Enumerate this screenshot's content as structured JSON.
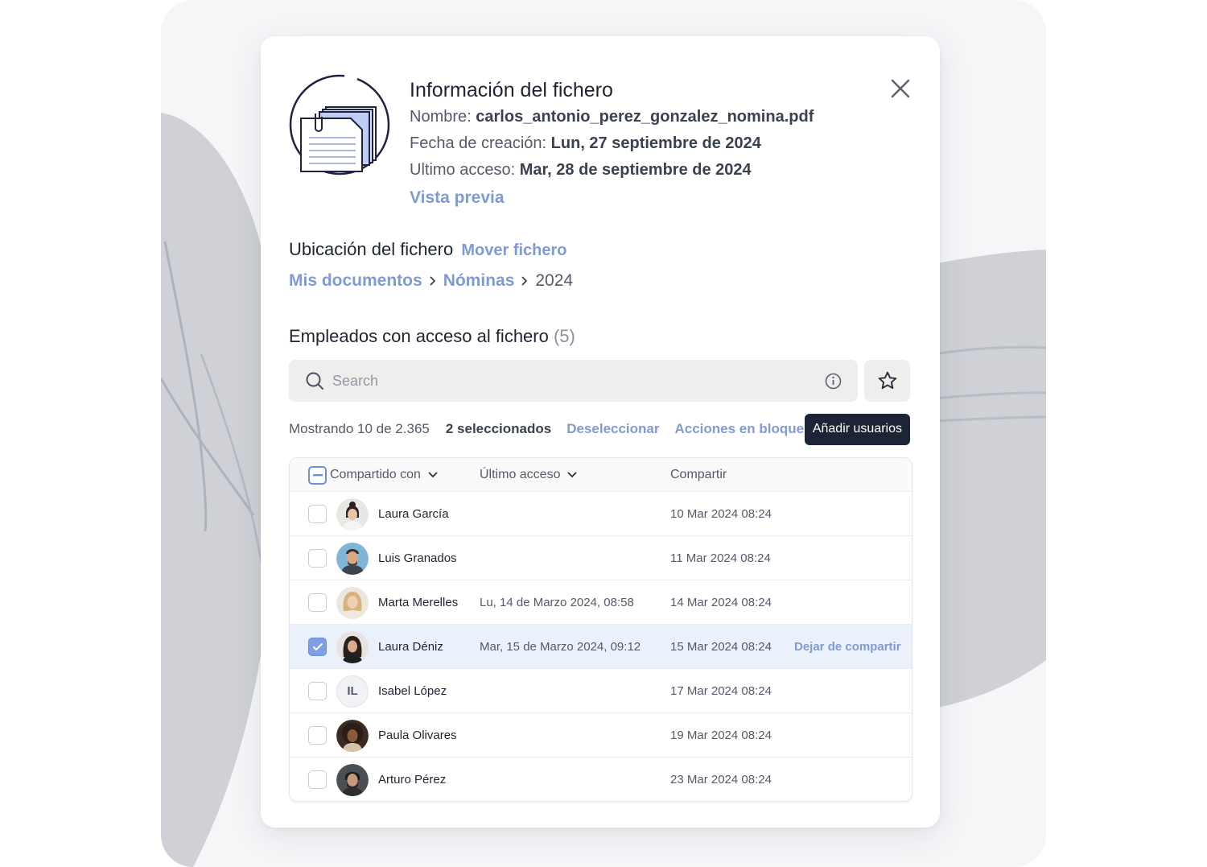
{
  "modal": {
    "title": "Información del fichero",
    "name_label": "Nombre:",
    "name_value": "carlos_antonio_perez_gonzalez_nomina.pdf",
    "created_label": "Fecha de creación:",
    "created_value": "Lun, 27 septiembre de 2024",
    "access_label": "Ultimo acceso:",
    "access_value": "Mar, 28 de septiembre de 2024",
    "preview_link": "Vista previa"
  },
  "location": {
    "title": "Ubicación del fichero",
    "move_link": "Mover fichero",
    "breadcrumb": [
      "Mis documentos",
      "Nóminas",
      "2024"
    ]
  },
  "employees": {
    "title": "Empleados con acceso al fichero",
    "count": "(5)",
    "search_placeholder": "Search",
    "showing": "Mostrando 10 de 2.365",
    "selected": "2 seleccionados",
    "deselect": "Deseleccionar",
    "bulk": "Acciones en bloque",
    "add_users": "Añadir usuarios"
  },
  "table": {
    "headers": {
      "shared_with": "Compartido con",
      "last_access": "Último acceso",
      "share": "Compartir"
    },
    "rows": [
      {
        "name": "Laura García",
        "last_access": "",
        "shared": "10 Mar 2024 08:24",
        "checked": false,
        "avatar": "photo-woman-1"
      },
      {
        "name": "Luis Granados",
        "last_access": "",
        "shared": "11 Mar 2024 08:24",
        "checked": false,
        "avatar": "photo-man-1"
      },
      {
        "name": "Marta Merelles",
        "last_access": "Lu, 14 de Marzo 2024, 08:58",
        "shared": "14 Mar 2024 08:24",
        "checked": false,
        "avatar": "photo-woman-2"
      },
      {
        "name": "Laura Déniz",
        "last_access": "Mar, 15 de Marzo 2024, 09:12",
        "shared": "15 Mar 2024 08:24",
        "checked": true,
        "avatar": "photo-woman-3",
        "action": "Dejar de compartir"
      },
      {
        "name": "Isabel López",
        "last_access": "",
        "shared": "17 Mar 2024 08:24",
        "checked": false,
        "avatar": "initials",
        "initials": "IL"
      },
      {
        "name": "Paula Olivares",
        "last_access": "",
        "shared": "19 Mar 2024 08:24",
        "checked": false,
        "avatar": "photo-woman-4"
      },
      {
        "name": "Arturo Pérez",
        "last_access": "",
        "shared": "23 Mar 2024 08:24",
        "checked": false,
        "avatar": "photo-man-2"
      }
    ]
  },
  "colors": {
    "accent_link": "#7f9bd6",
    "primary_button": "#1d2435",
    "selected_row": "#eaf1fb"
  }
}
